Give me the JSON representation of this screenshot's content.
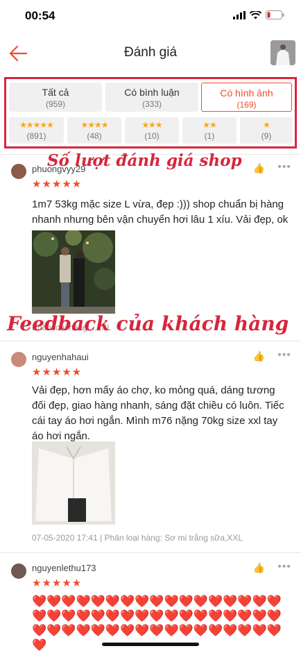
{
  "status": {
    "time": "00:54"
  },
  "nav": {
    "title": "Đánh giá"
  },
  "tabs": [
    {
      "label": "Tất cả",
      "count": "(959)"
    },
    {
      "label": "Có bình luận",
      "count": "(333)"
    },
    {
      "label": "Có hình ảnh",
      "count": "(169)"
    }
  ],
  "star_filters": [
    {
      "stars": "★★★★★",
      "count": "(891)"
    },
    {
      "stars": "★★★★",
      "count": "(48)"
    },
    {
      "stars": "★★★",
      "count": "(10)"
    },
    {
      "stars": "★★",
      "count": "(1)"
    },
    {
      "stars": "★",
      "count": "(9)"
    }
  ],
  "annotations": {
    "top": "Số lượt đánh giá shop",
    "middle": "Feedback của khách hàng"
  },
  "reviews": [
    {
      "username": "phuongvyy29",
      "stars": "★★★★★",
      "text": "1m7 53kg mặc size L vừa, đẹp :))) shop chuẩn bị hàng nhanh nhưng bên vận chuyển hơi lâu 1 xíu. Vải đẹp, ok",
      "meta": "Phân loại hàng: ...,XL"
    },
    {
      "username": "nguyenhahaui",
      "stars": "★★★★★",
      "text": "Vải đẹp, hơn mấy áo chợ, ko mỏng quá, dáng tương đối đẹp, giao hàng nhanh, sáng đặt chiều có luôn. Tiếc cái tay áo hơi ngắn. Mình m76 nặng 70kg size xxl tay áo hơi ngắn.",
      "meta": "07-05-2020 17:41 | Phân loại hàng: Sơ mi trắng sữa,XXL"
    },
    {
      "username": "nguyenlethu173",
      "stars": "★★★★★",
      "text": "❤️❤️❤️❤️❤️❤️❤️❤️❤️❤️❤️❤️❤️❤️❤️❤️❤️❤️❤️❤️❤️❤️❤️❤️❤️❤️❤️❤️❤️❤️❤️❤️❤️❤️❤️❤️❤️❤️❤️❤️❤️❤️❤️❤️❤️❤️❤️❤️❤️❤️❤️❤️",
      "meta": ""
    }
  ],
  "colors": {
    "accent": "#ee4d2d",
    "annotation": "#d7263d",
    "star": "#f5a623"
  }
}
